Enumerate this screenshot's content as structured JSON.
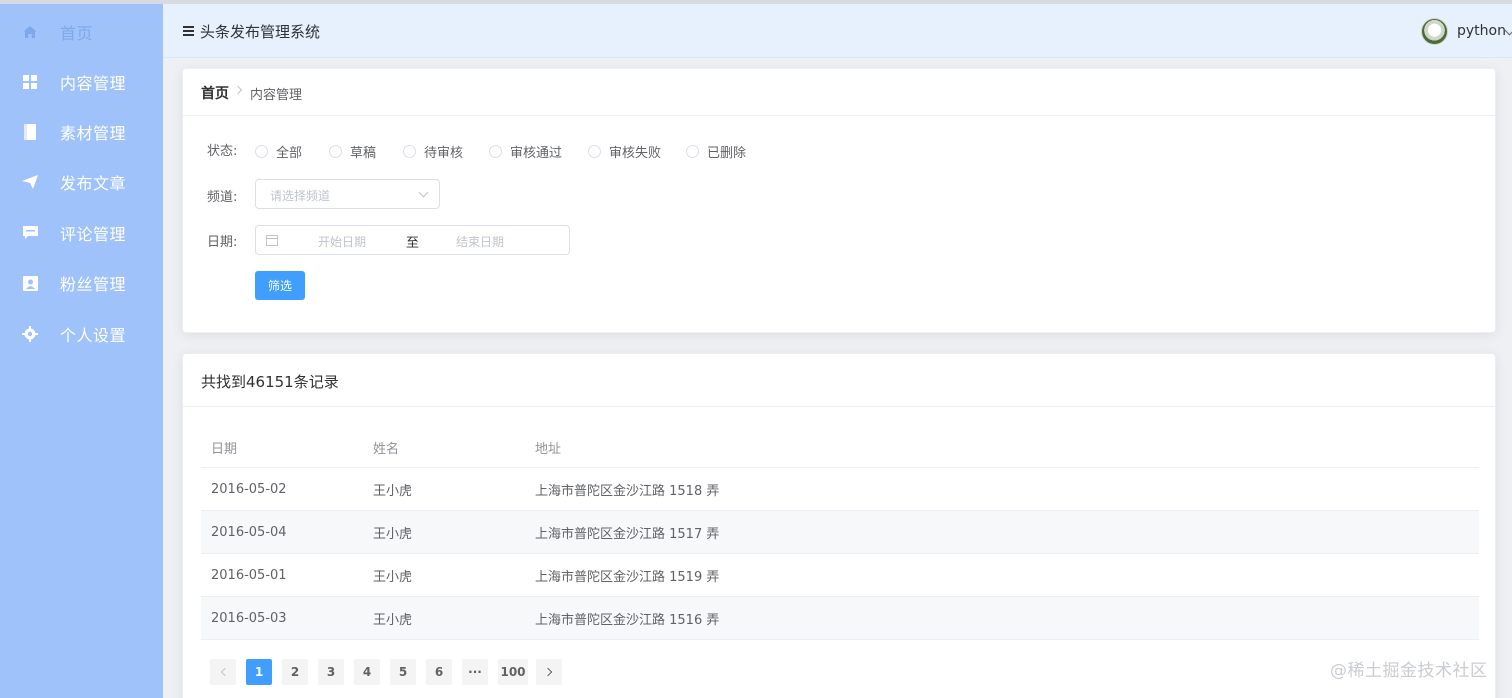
{
  "header": {
    "title": "头条发布管理系统",
    "username": "python"
  },
  "sidebar": {
    "items": [
      {
        "label": "首页",
        "icon": "home-icon",
        "active": true
      },
      {
        "label": "内容管理",
        "icon": "grid-icon"
      },
      {
        "label": "素材管理",
        "icon": "book-icon"
      },
      {
        "label": "发布文章",
        "icon": "paper-plane-icon"
      },
      {
        "label": "评论管理",
        "icon": "comment-icon"
      },
      {
        "label": "粉丝管理",
        "icon": "user-card-icon"
      },
      {
        "label": "个人设置",
        "icon": "gear-icon"
      }
    ]
  },
  "breadcrumb": {
    "home": "首页",
    "current": "内容管理"
  },
  "filter": {
    "status_label": "状态:",
    "status_options": [
      "全部",
      "草稿",
      "待审核",
      "审核通过",
      "审核失败",
      "已删除"
    ],
    "channel_label": "频道:",
    "channel_placeholder": "请选择频道",
    "date_label": "日期:",
    "date_start_placeholder": "开始日期",
    "date_separator": "至",
    "date_end_placeholder": "结束日期",
    "submit_label": "筛选"
  },
  "results": {
    "summary": "共找到46151条记录",
    "columns": [
      "日期",
      "姓名",
      "地址"
    ],
    "rows": [
      [
        "2016-05-02",
        "王小虎",
        "上海市普陀区金沙江路 1518 弄"
      ],
      [
        "2016-05-04",
        "王小虎",
        "上海市普陀区金沙江路 1517 弄"
      ],
      [
        "2016-05-01",
        "王小虎",
        "上海市普陀区金沙江路 1519 弄"
      ],
      [
        "2016-05-03",
        "王小虎",
        "上海市普陀区金沙江路 1516 弄"
      ]
    ]
  },
  "pagination": {
    "pages": [
      "1",
      "2",
      "3",
      "4",
      "5",
      "6",
      "···",
      "100"
    ],
    "current": 1
  },
  "watermark": "@稀土掘金技术社区",
  "colors": {
    "sidebar_bg": "#9fc2fa",
    "header_bg": "#e7f0fd",
    "primary": "#409eff"
  }
}
